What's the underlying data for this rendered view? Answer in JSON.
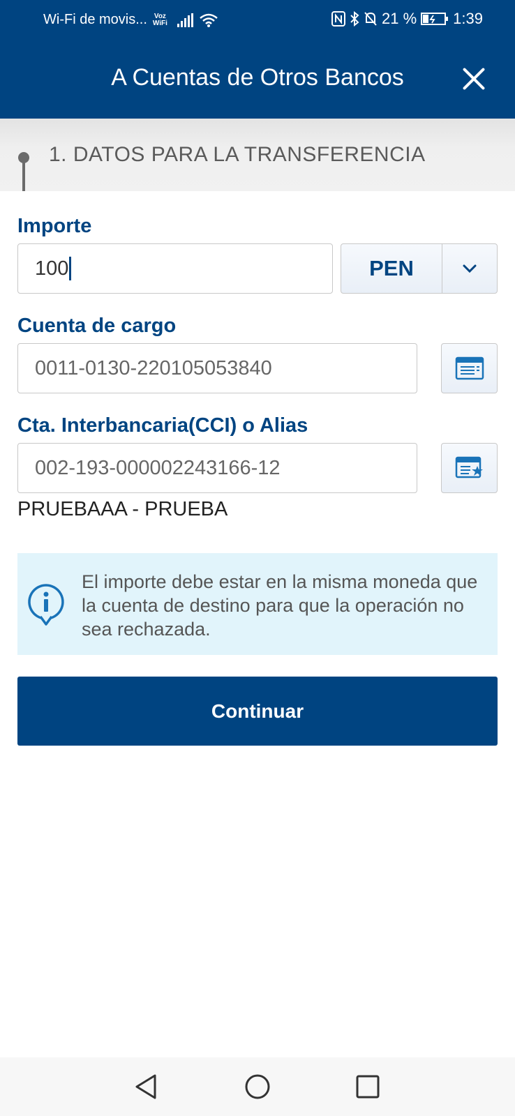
{
  "status_bar": {
    "carrier": "Wi-Fi de movis...",
    "voz_top": "Voz",
    "voz_bottom": "WiFi",
    "battery": "21 %",
    "time": "1:39",
    "icons": [
      "signal-icon",
      "wifi-icon",
      "nfc-icon",
      "bluetooth-icon",
      "bell-muted-icon",
      "battery-icon"
    ]
  },
  "header": {
    "title": "A Cuentas de Otros Bancos",
    "close_icon": "close-icon"
  },
  "step": {
    "title": "1. DATOS PARA LA TRANSFERENCIA"
  },
  "form": {
    "amount_label": "Importe",
    "amount_value": "100",
    "currency": "PEN",
    "charge_account_label": "Cuenta de cargo",
    "charge_account_value": "0011-0130-220105053840",
    "cci_label": "Cta. Interbancaria(CCI) o Alias",
    "cci_value": "002-193-000002243166-12",
    "beneficiary": "PRUEBAAA - PRUEBA"
  },
  "info": {
    "message": "El importe debe estar en la misma moneda que la cuenta de destino para que la operación no sea rechazada."
  },
  "actions": {
    "continue_label": "Continuar"
  },
  "colors": {
    "primary": "#004481",
    "info_bg": "#e1f4fb",
    "info_icon": "#1973b8"
  }
}
